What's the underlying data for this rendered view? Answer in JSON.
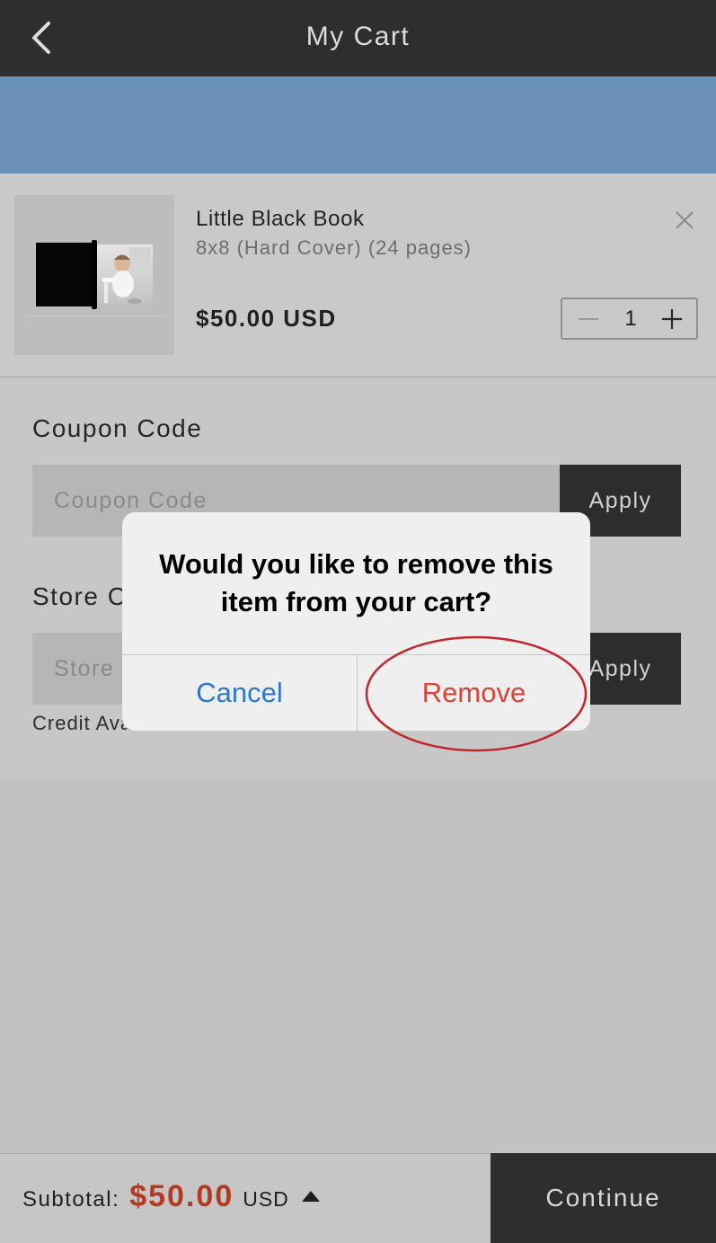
{
  "header": {
    "title": "My Cart",
    "back_icon": "chevron-left-icon"
  },
  "cart_item": {
    "name": "Little Black Book",
    "details": "8x8 (Hard Cover) (24 pages)",
    "price": "$50.00 USD",
    "quantity": "1",
    "remove_icon": "close-icon",
    "decrement_icon": "minus-icon",
    "increment_icon": "plus-icon"
  },
  "coupon": {
    "label": "Coupon Code",
    "placeholder": "Coupon Code",
    "apply_label": "Apply"
  },
  "store_section": {
    "label": "Store C",
    "placeholder": "Store",
    "apply_label": "Apply",
    "note": "Credit Ava"
  },
  "footer": {
    "subtotal_label": "Subtotal:",
    "subtotal_amount": "$50.00",
    "currency": "USD",
    "toggle_icon": "caret-up-icon",
    "continue_label": "Continue"
  },
  "dialog": {
    "message": "Would you like to remove this item from your cart?",
    "cancel_label": "Cancel",
    "remove_label": "Remove"
  },
  "colors": {
    "header_bg": "#2e2e2e",
    "banner": "#6a92b8",
    "price_red": "#b43a21",
    "cancel_blue": "#2f76d2",
    "remove_red": "#d8443a",
    "annotation": "#c1272d"
  }
}
